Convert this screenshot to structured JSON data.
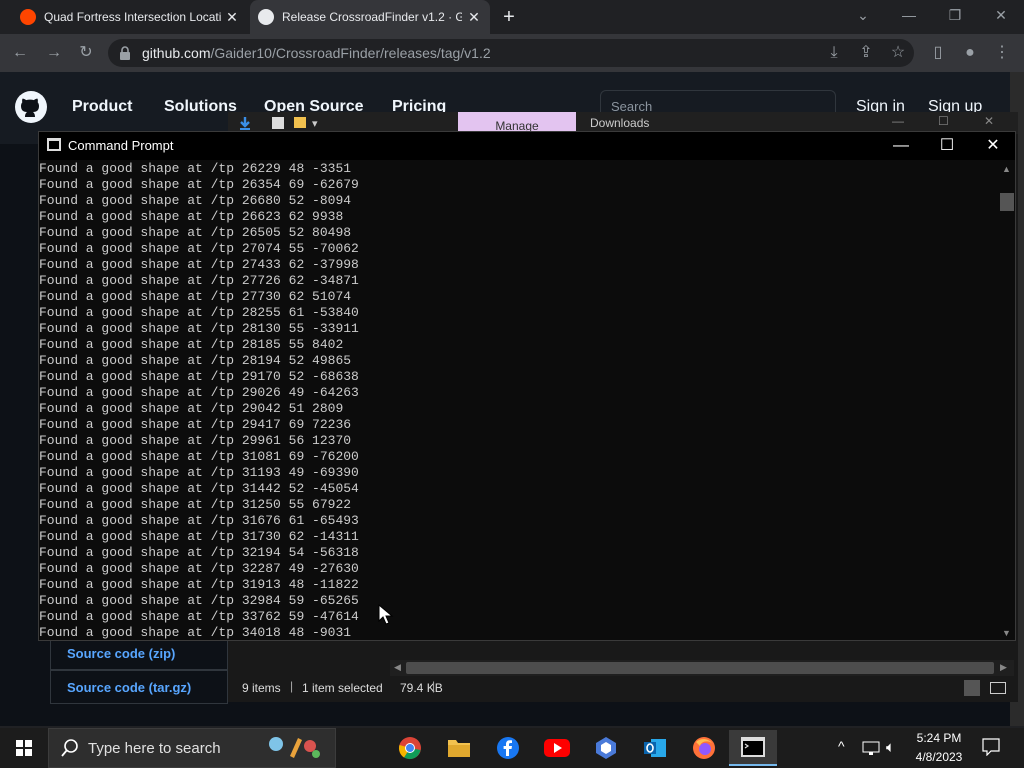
{
  "browser": {
    "tabs": [
      {
        "title": "Quad Fortress Intersection Locati",
        "favicon": "reddit-icon"
      },
      {
        "title": "Release CrossroadFinder v1.2 · Gi",
        "favicon": "github-icon"
      }
    ],
    "url_host": "github.com",
    "url_path": "/Gaider10/CrossroadFinder/releases/tag/v1.2"
  },
  "github": {
    "nav": [
      "Product",
      "Solutions",
      "Open Source",
      "Pricing"
    ],
    "search_placeholder": "Search",
    "sign_in": "Sign in",
    "sign_up": "Sign up",
    "assets": [
      "Source code (zip)",
      "Source code (tar.gz)"
    ]
  },
  "explorer": {
    "manage_tab": "Manage",
    "title": "Downloads",
    "status_items": "9 items",
    "status_selected": "1 item selected",
    "status_size": "79.4 KB"
  },
  "cmd": {
    "title": "Command Prompt",
    "lines": [
      "Found a good shape at /tp 26229 48 -3351",
      "Found a good shape at /tp 26354 69 -62679",
      "Found a good shape at /tp 26680 52 -8094",
      "Found a good shape at /tp 26623 62 9938",
      "Found a good shape at /tp 26505 52 80498",
      "Found a good shape at /tp 27074 55 -70062",
      "Found a good shape at /tp 27433 62 -37998",
      "Found a good shape at /tp 27726 62 -34871",
      "Found a good shape at /tp 27730 62 51074",
      "Found a good shape at /tp 28255 61 -53840",
      "Found a good shape at /tp 28130 55 -33911",
      "Found a good shape at /tp 28185 55 8402",
      "Found a good shape at /tp 28194 52 49865",
      "Found a good shape at /tp 29170 52 -68638",
      "Found a good shape at /tp 29026 49 -64263",
      "Found a good shape at /tp 29042 51 2809",
      "Found a good shape at /tp 29417 69 72236",
      "Found a good shape at /tp 29961 56 12370",
      "Found a good shape at /tp 31081 69 -76200",
      "Found a good shape at /tp 31193 49 -69390",
      "Found a good shape at /tp 31442 52 -45054",
      "Found a good shape at /tp 31250 55 67922",
      "Found a good shape at /tp 31676 61 -65493",
      "Found a good shape at /tp 31730 62 -14311",
      "Found a good shape at /tp 32194 54 -56318",
      "Found a good shape at /tp 32287 49 -27630",
      "Found a good shape at /tp 31913 48 -11822",
      "Found a good shape at /tp 32984 59 -65265",
      "Found a good shape at /tp 33762 59 -47614",
      "Found a good shape at /tp 34018 48 -9031"
    ]
  },
  "taskbar": {
    "search_placeholder": "Type here to search",
    "apps": [
      "chrome-icon",
      "file-explorer-icon",
      "facebook-icon",
      "youtube-icon",
      "copilot-icon",
      "outlook-icon",
      "firefox-icon",
      "command-prompt-icon"
    ],
    "time": "5:24 PM",
    "date": "4/8/2023"
  },
  "colors": {
    "github_bg": "#0d1117",
    "cmd_text": "#cccccc",
    "link_blue": "#58a6ff",
    "manage_tab": "#e3c4f0"
  }
}
